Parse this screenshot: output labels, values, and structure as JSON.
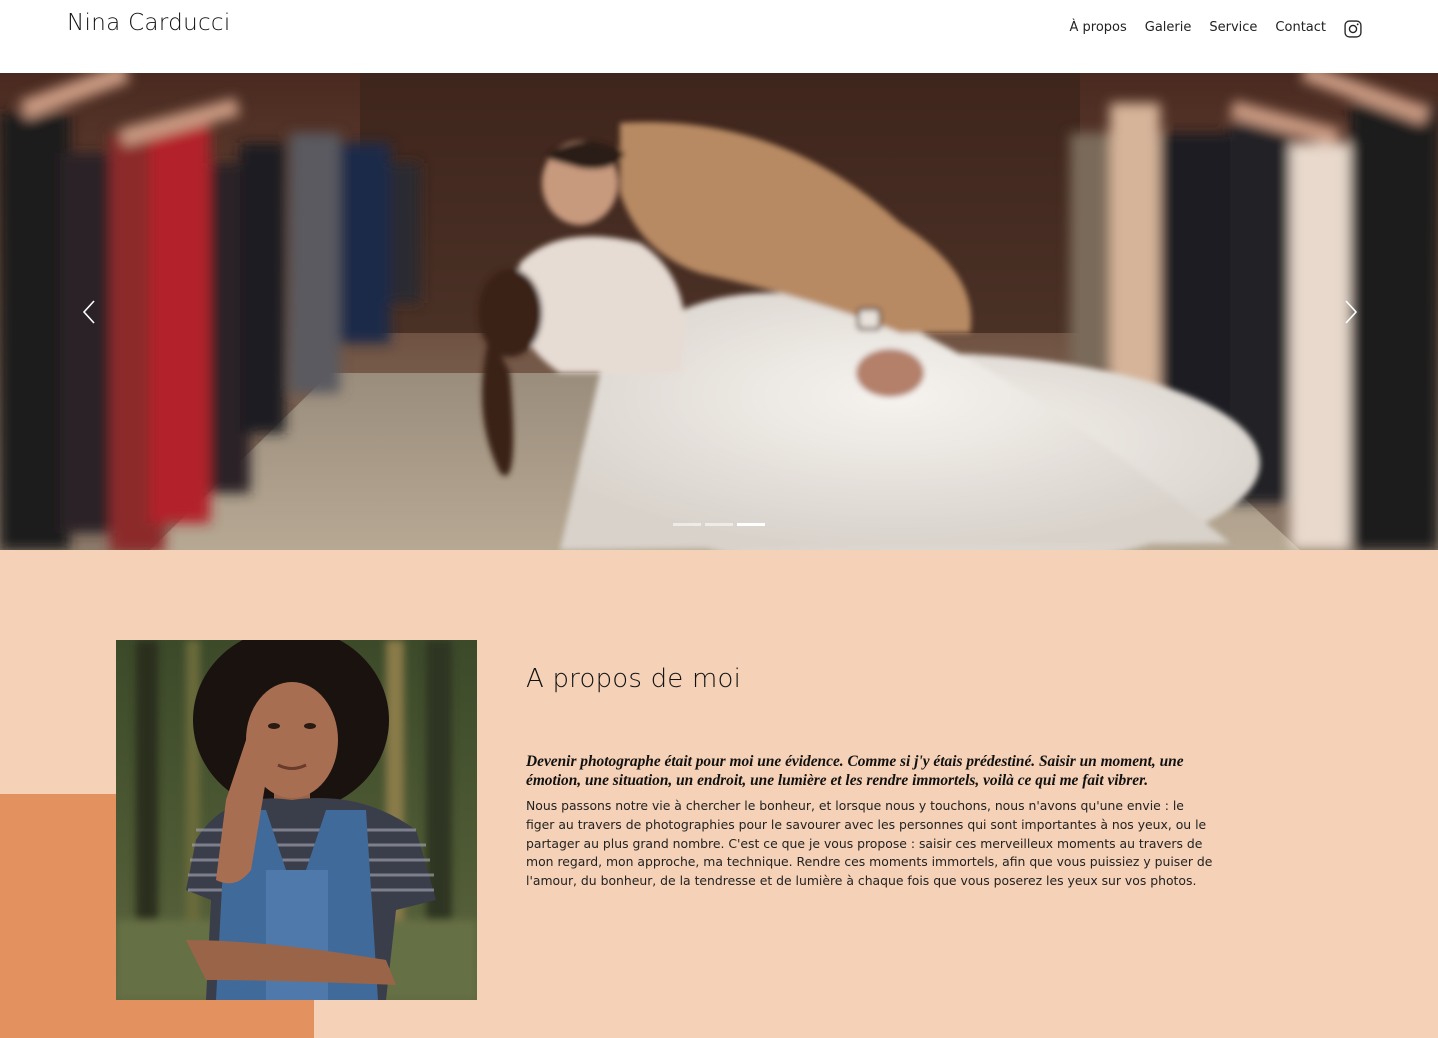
{
  "header": {
    "brand": "Nina Carducci",
    "nav": [
      {
        "label": "À propos"
      },
      {
        "label": "Galerie"
      },
      {
        "label": "Service"
      },
      {
        "label": "Contact"
      }
    ],
    "social_icon": "instagram-icon"
  },
  "carousel": {
    "prev_icon": "chevron-left-icon",
    "next_icon": "chevron-right-icon",
    "slide_count": 3,
    "active_slide": 3
  },
  "about": {
    "title": "A propos de moi",
    "lead": "Devenir photographe était pour moi une évidence. Comme si j'y étais prédestiné. Saisir un moment, une émotion, une situation, un endroit, une lumière et les rendre immortels, voilà ce qui me fait vibrer.",
    "body": "Nous passons notre vie à chercher le bonheur, et lorsque nous y touchons, nous n'avons qu'une envie : le figer au travers de photographies pour le savourer avec les personnes qui sont importantes à nos yeux, ou le partager au plus grand nombre. C'est ce que je vous propose : saisir ces merveilleux moments au travers de mon regard, mon approche, ma technique. Rendre ces moments immortels, afin que vous puissiez y puiser de l'amour, du bonheur, de la tendresse et de lumière à chaque fois que vous poserez les yeux sur vos photos."
  },
  "colors": {
    "section_bg": "#f4d1b7",
    "accent": "#e3925f"
  }
}
